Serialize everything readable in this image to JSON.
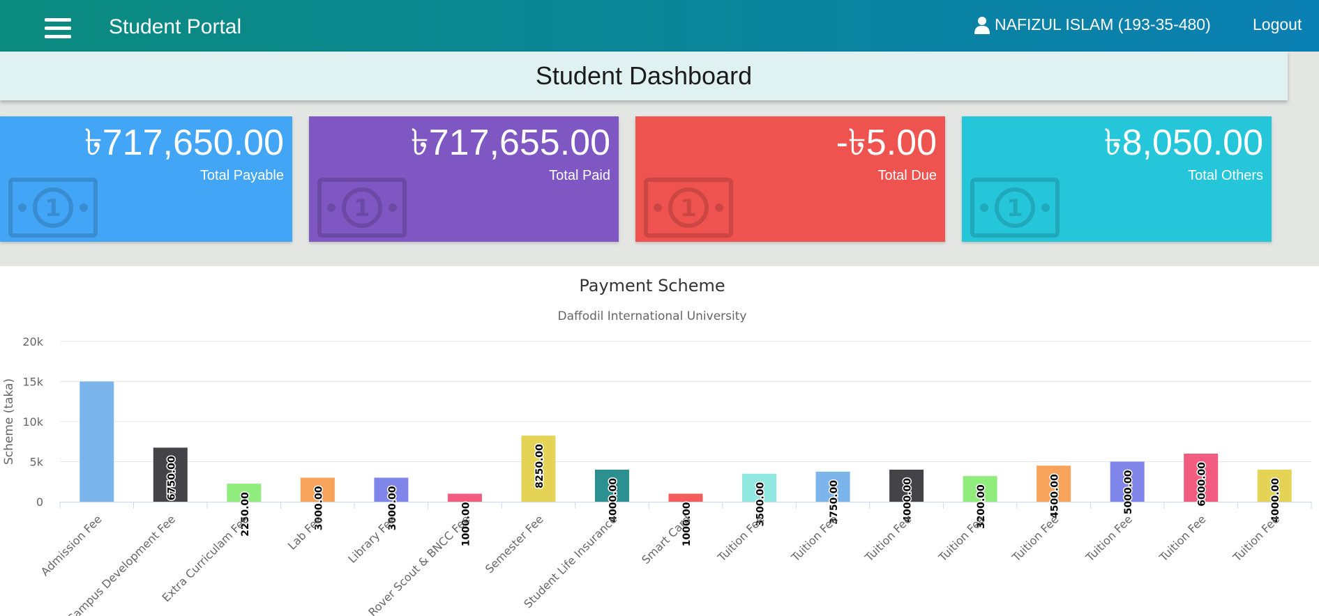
{
  "header": {
    "app_title": "Student Portal",
    "user_name": "NAFIZUL ISLAM (193-35-480)",
    "logout_label": "Logout",
    "menu_icon": "hamburger-icon",
    "user_icon": "user-icon"
  },
  "dashboard": {
    "title": "Student Dashboard",
    "cards": [
      {
        "amount": "৳717,650.00",
        "label": "Total Payable",
        "color": "#42a5f5",
        "icon": "money-bill-icon"
      },
      {
        "amount": "৳717,655.00",
        "label": "Total Paid",
        "color": "#7e57c2",
        "icon": "money-bill-icon"
      },
      {
        "amount": "-৳5.00",
        "label": "Total Due",
        "color": "#ef5350",
        "icon": "money-bill-icon"
      },
      {
        "amount": "৳8,050.00",
        "label": "Total Others",
        "color": "#26c6da",
        "icon": "money-bill-icon"
      }
    ]
  },
  "chart_data": {
    "type": "bar",
    "title": "Payment Scheme",
    "subtitle": "Daffodil International University",
    "xlabel": "",
    "ylabel": "Scheme (taka)",
    "ylim": [
      0,
      20000
    ],
    "yticks": [
      "0",
      "5k",
      "10k",
      "15k",
      "20k"
    ],
    "grid": true,
    "categories": [
      "Admission Fee",
      "Campus Development Fee",
      "Extra Curriculam Fee",
      "Lab Fee",
      "Library Fee",
      "Rover Scout & BNCC Fee",
      "Semester Fee",
      "Student Life Insurance",
      "Smart Card",
      "Tuition Fee",
      "Tuition Fee",
      "Tuition Fee",
      "Tuition Fee",
      "Tuition Fee",
      "Tuition Fee",
      "Tuition Fee",
      "Tuition Fee"
    ],
    "values": [
      15000,
      6750,
      2250,
      3000,
      3000,
      1000,
      8250,
      4000,
      1000,
      3500,
      3750,
      4000,
      3200,
      4500,
      5000,
      6000,
      4000
    ],
    "data_labels": [
      "",
      "6750.00",
      "2250.00",
      "3000.00",
      "3000.00",
      "1000.00",
      "8250.00",
      "4000.00",
      "1000.00",
      "3500.00",
      "3750.00",
      "4000.00",
      "3200.00",
      "4500.00",
      "5000.00",
      "6000.00",
      "4000.00"
    ],
    "colors": [
      "#7cb5ec",
      "#434348",
      "#90ed7d",
      "#f7a35c",
      "#8085e9",
      "#f15c80",
      "#e4d354",
      "#2b908f",
      "#f45b5b",
      "#91e8e1",
      "#7cb5ec",
      "#434348",
      "#90ed7d",
      "#f7a35c",
      "#8085e9",
      "#f15c80",
      "#e4d354"
    ]
  }
}
